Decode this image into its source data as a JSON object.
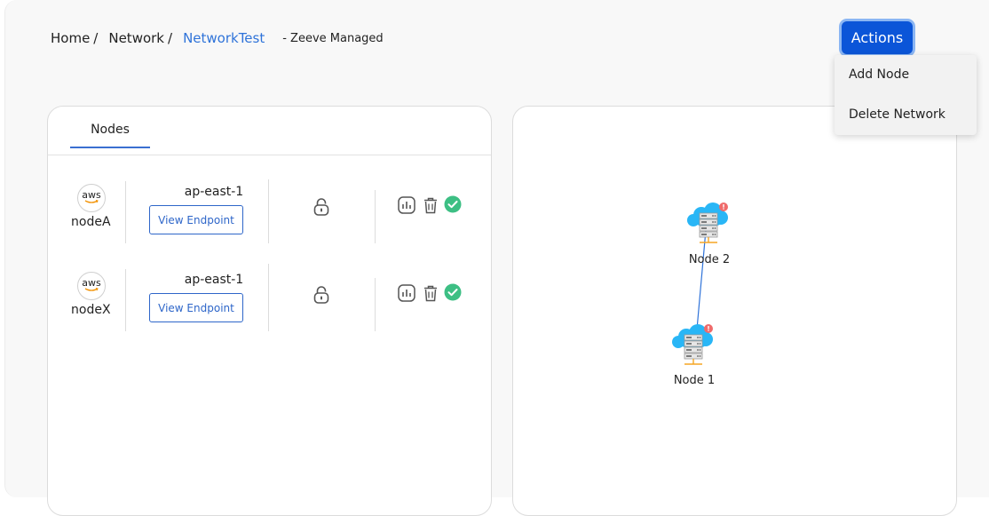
{
  "breadcrumb": {
    "home": "Home",
    "network": "Network",
    "separator": "/",
    "current": "NetworkTest",
    "managed": "- Zeeve Managed"
  },
  "actions": {
    "label": "Actions",
    "menu": [
      "Add Node",
      "Delete Network"
    ]
  },
  "nodes_panel": {
    "tab": "Nodes",
    "rows": [
      {
        "provider": "aws",
        "name": "nodeA",
        "region": "ap-east-1",
        "endpoint_label": "View Endpoint"
      },
      {
        "provider": "aws",
        "name": "nodeX",
        "region": "ap-east-1",
        "endpoint_label": "View Endpoint"
      }
    ]
  },
  "topology": {
    "nodes": [
      "Node 2",
      "Node 1"
    ]
  },
  "colors": {
    "accent": "#0b55d8",
    "link": "#2f73d9",
    "status_ok": "#3dbf84",
    "cloud": "#29b6f6",
    "alert": "#ef6b6b"
  },
  "icons": {
    "provider": "aws-logo-icon",
    "lock": "lock-icon",
    "stats": "bar-chart-icon",
    "delete": "trash-icon",
    "status": "check-circle-icon",
    "server": "cloud-server-icon"
  }
}
